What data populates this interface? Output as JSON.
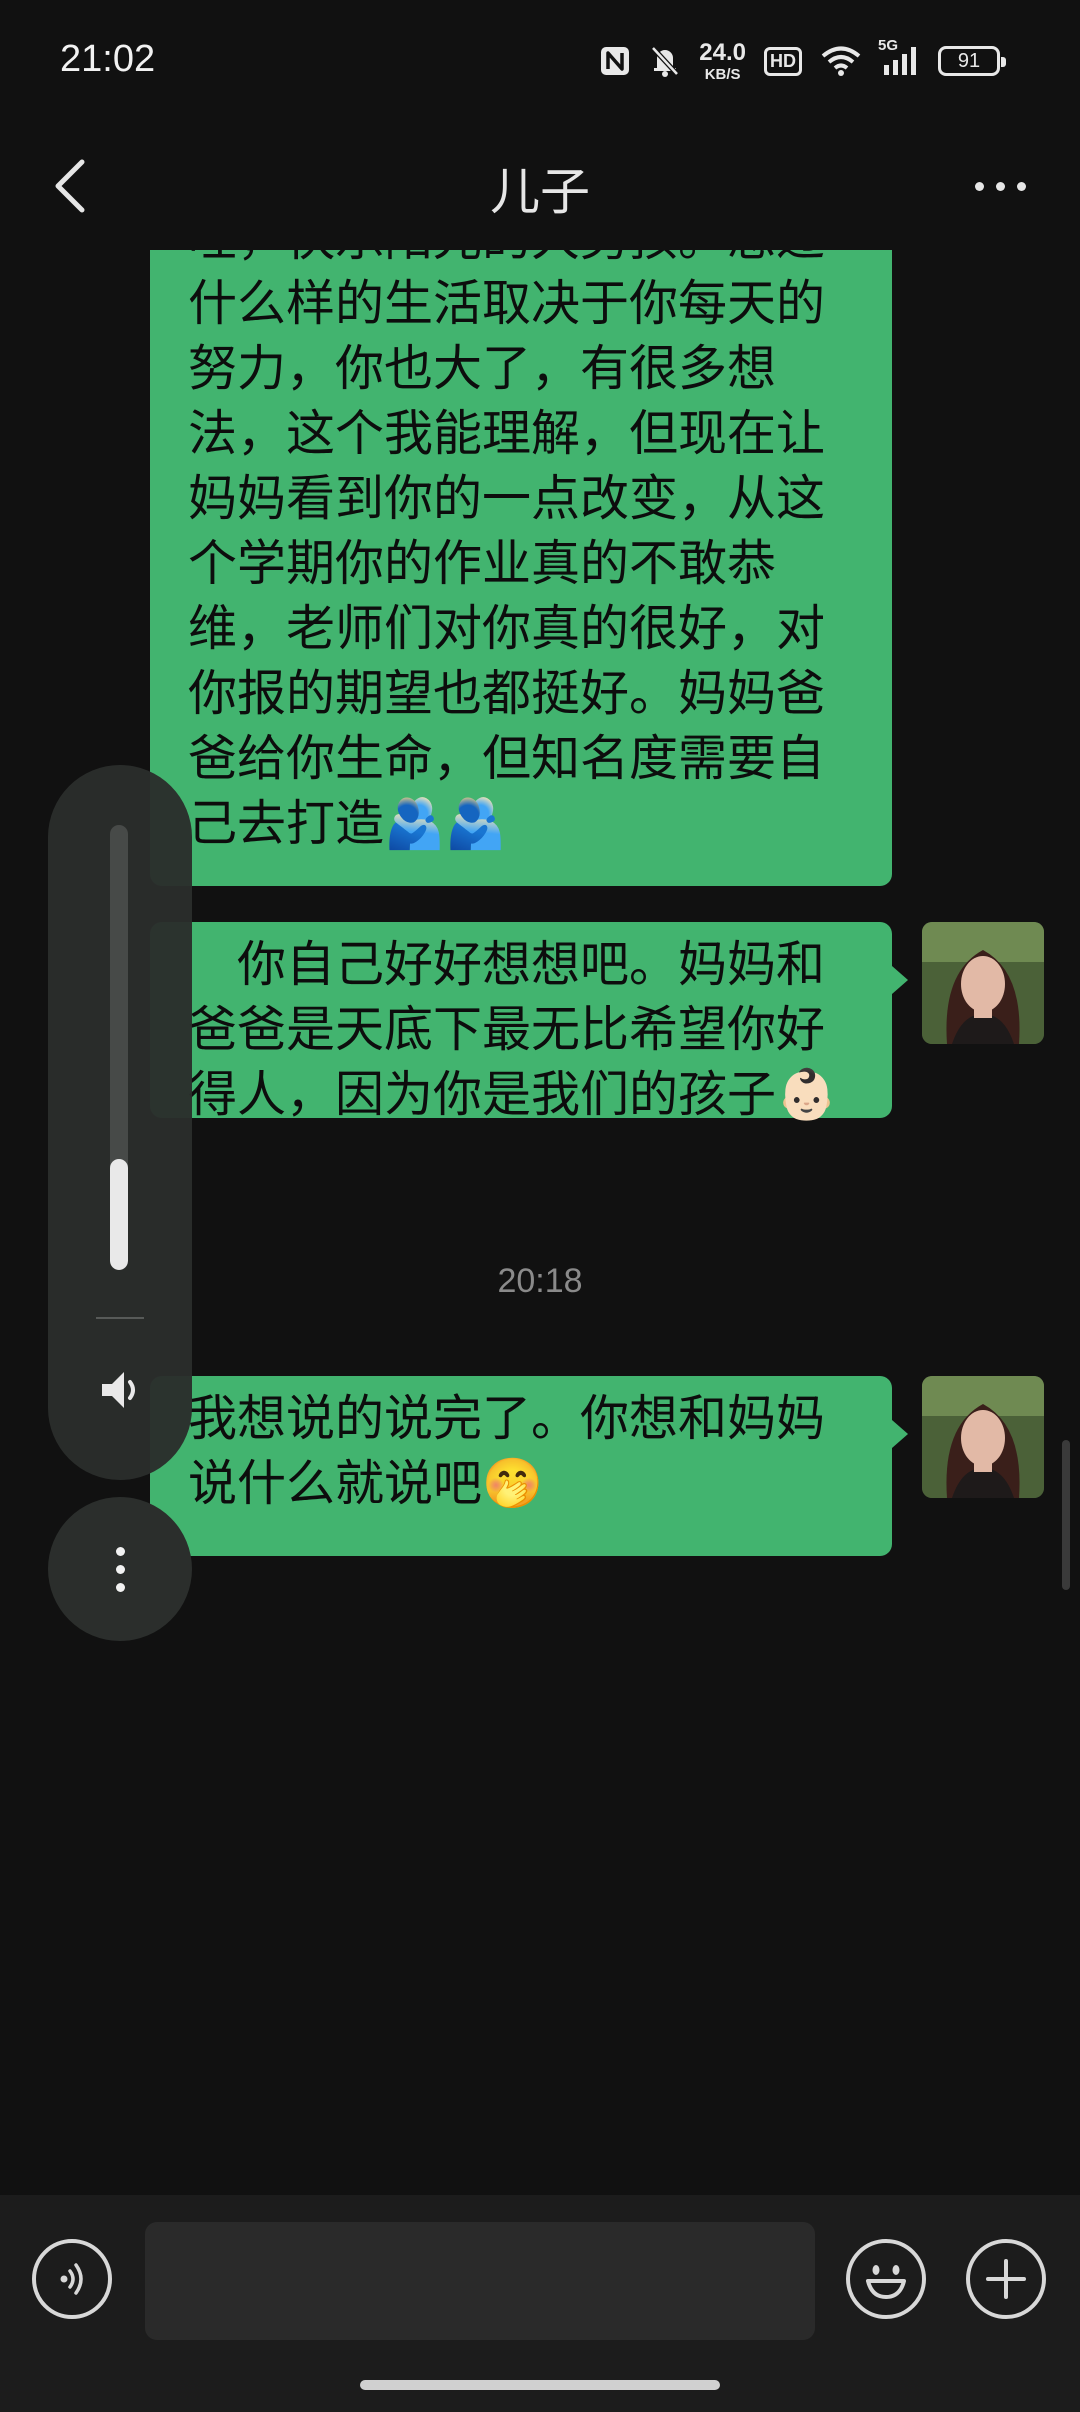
{
  "status_bar": {
    "time": "21:02",
    "net_speed_value": "24.0",
    "net_speed_unit": "KB/S",
    "hd_label": "HD",
    "signal_label": "5G",
    "battery_level": "91",
    "icons": [
      "nfc-icon",
      "mute-bell-icon",
      "wifi-icon",
      "signal-icon",
      "battery-icon"
    ]
  },
  "header": {
    "title": "儿子",
    "back_icon": "chevron-left-icon",
    "more_icon": "more-dots-icon"
  },
  "messages": [
    {
      "sender": "me",
      "text": "哇，快乐阳光的大男孩。想过什么样的生活取决于你每天的努力，你也大了，有很多想法，这个我能理解，但现在让妈妈看到你的一点改变，从这个学期你的作业真的不敢恭维，老师们对你真的很好，对你报的期望也都挺好。妈妈爸爸给你生命，但知名度需要自己去打造🫂🫂"
    },
    {
      "sender": "me",
      "text": "　你自己好好想想吧。妈妈和爸爸是天底下最无比希望你好得人，因为你是我们的孩子👶🏻"
    },
    {
      "sender": "me",
      "text": "我想说的说完了。你想和妈妈说什么就说吧🤭"
    }
  ],
  "timestamp": "20:18",
  "volume": {
    "level": 0.25,
    "speaker_icon": "speaker-icon",
    "more_icon": "vertical-dots-icon"
  },
  "input_bar": {
    "message_value": "",
    "voice_icon": "voice-icon",
    "emoji_icon": "smiley-icon",
    "plus_icon": "plus-icon"
  },
  "colors": {
    "background": "#111111",
    "bubble": "#42b46f",
    "input_bar": "#1c1c1c"
  }
}
